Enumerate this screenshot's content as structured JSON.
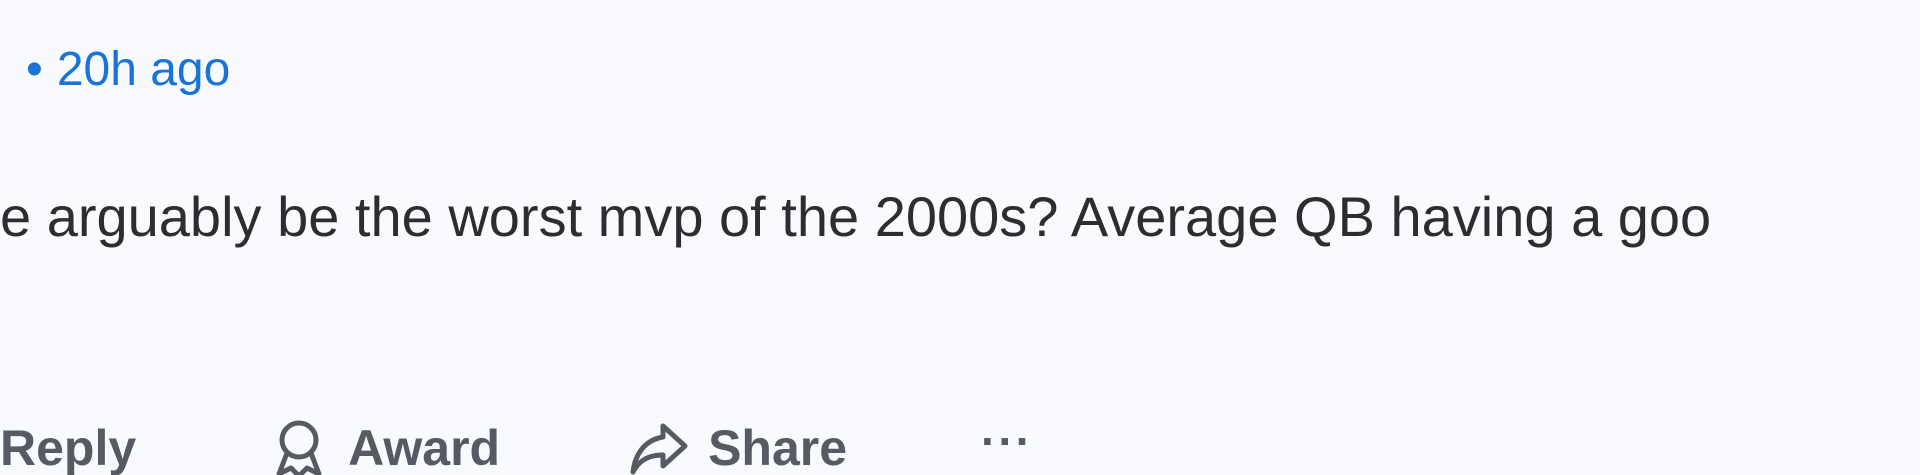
{
  "comment": {
    "timestamp": "20h ago",
    "separator": "•",
    "body": "e arguably be the worst mvp of the 2000s? Average QB having a goo"
  },
  "actions": {
    "reply_label": "Reply",
    "award_label": "Award",
    "share_label": "Share",
    "more_label": "···"
  },
  "icons": {
    "award": "award-icon",
    "share": "share-icon"
  },
  "colors": {
    "background": "#f9fafe",
    "timestamp": "#1a73d9",
    "body_text": "#2b2d31",
    "action_text": "#555a63"
  }
}
